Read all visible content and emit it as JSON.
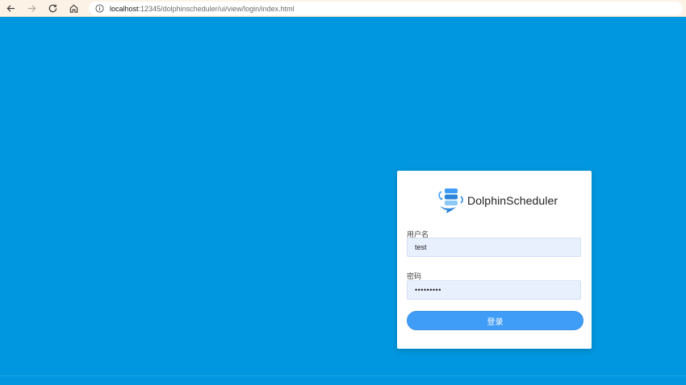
{
  "browser": {
    "url_host": "localhost",
    "url_path": ":12345/dolphinscheduler/ui/view/login/index.html"
  },
  "colors": {
    "background": "#0097e0",
    "card": "#ffffff",
    "primary_button": "#3f9cf7",
    "input_fill": "#e8f0fe"
  },
  "login": {
    "brand_name": "DolphinScheduler",
    "username_label": "用户名",
    "username_value": "test",
    "password_label": "密码",
    "password_mask": "•••••••••",
    "submit_label": "登录"
  },
  "icons": {
    "back": "arrow-left-icon",
    "forward": "arrow-right-icon",
    "reload": "reload-icon",
    "home": "home-icon",
    "site_info": "info-icon",
    "logo": "dolphinscheduler-logo-icon"
  }
}
